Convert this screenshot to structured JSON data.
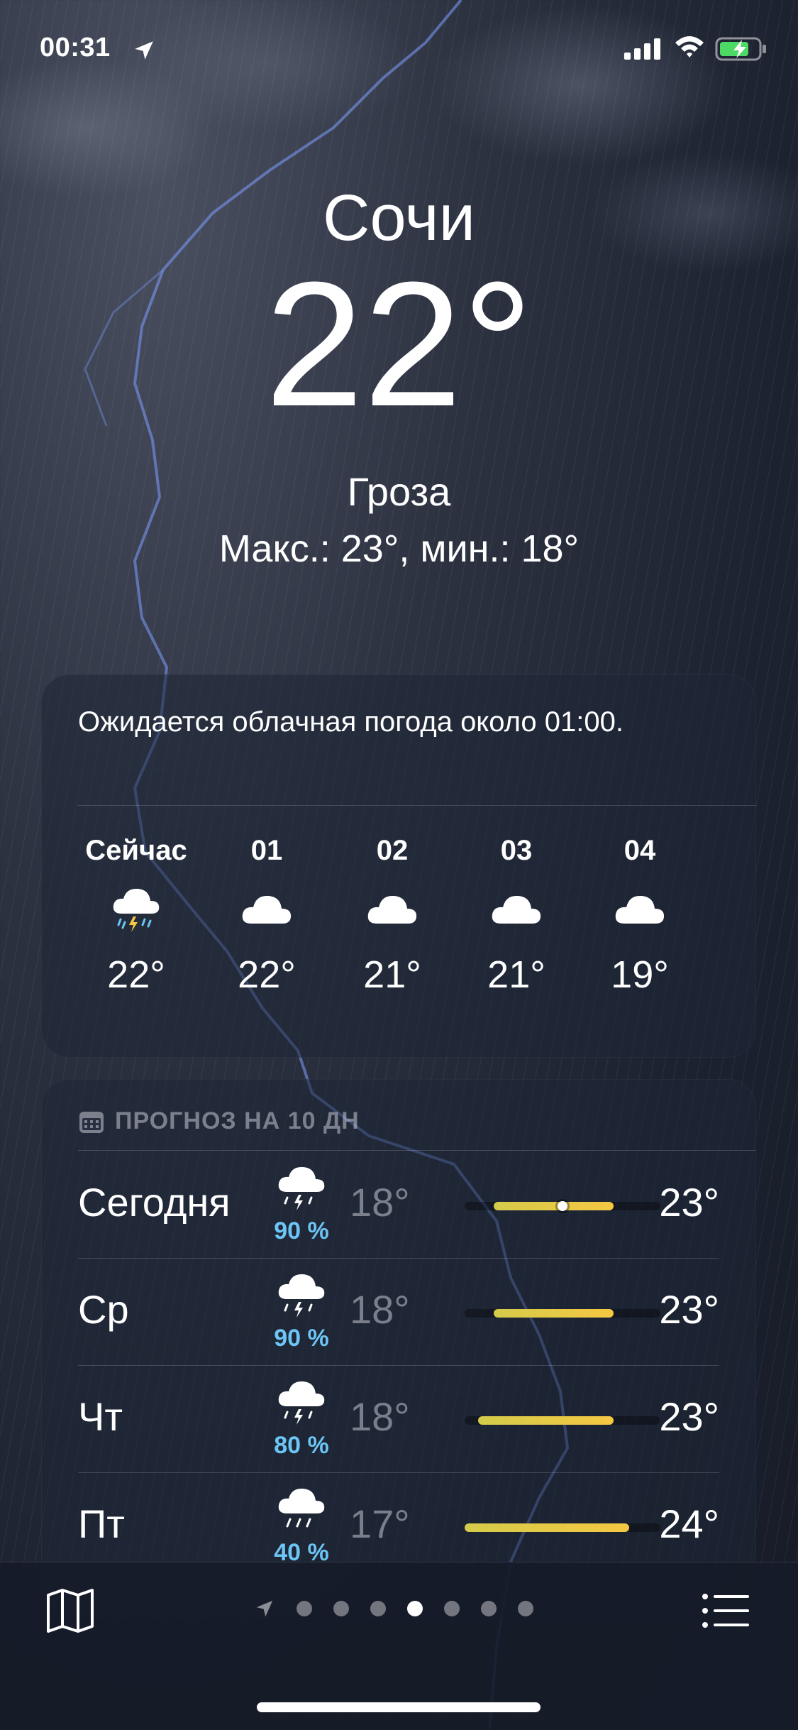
{
  "status_bar": {
    "time": "00:31"
  },
  "header": {
    "city": "Сочи",
    "temperature": "22°",
    "condition": "Гроза",
    "high_low": "Макс.: 23°, мин.: 18°"
  },
  "hourly": {
    "summary": "Ожидается облачная погода около 01:00.",
    "items": [
      {
        "label": "Сейчас",
        "icon": "cloud-bolt-rain-icon",
        "temp": "22°"
      },
      {
        "label": "01",
        "icon": "cloud-icon",
        "temp": "22°"
      },
      {
        "label": "02",
        "icon": "cloud-icon",
        "temp": "21°"
      },
      {
        "label": "03",
        "icon": "cloud-icon",
        "temp": "21°"
      },
      {
        "label": "04",
        "icon": "cloud-icon",
        "temp": "19°"
      }
    ]
  },
  "daily": {
    "title": "ПРОГНОЗ НА 10 ДН",
    "range_fill_fraction_note": "bar spans shown as fractions of the track",
    "days": [
      {
        "day": "Сегодня",
        "icon": "cloud-bolt-rain-icon",
        "precip": "90 %",
        "low": "18°",
        "high": "23°",
        "bar_start": 0.15,
        "bar_end": 0.76,
        "current": 0.5
      },
      {
        "day": "Ср",
        "icon": "cloud-bolt-rain-icon",
        "precip": "90 %",
        "low": "18°",
        "high": "23°",
        "bar_start": 0.15,
        "bar_end": 0.76
      },
      {
        "day": "Чт",
        "icon": "cloud-bolt-rain-icon",
        "precip": "80 %",
        "low": "18°",
        "high": "23°",
        "bar_start": 0.07,
        "bar_end": 0.76
      },
      {
        "day": "Пт",
        "icon": "cloud-rain-icon",
        "precip": "40 %",
        "low": "17°",
        "high": "24°",
        "bar_start": 0.0,
        "bar_end": 0.84
      }
    ]
  },
  "pager": {
    "pages": 7,
    "active_index": 3
  },
  "colors": {
    "precip": "#6cc5f5",
    "bar": "#f5c842",
    "battery": "#4cd964"
  }
}
